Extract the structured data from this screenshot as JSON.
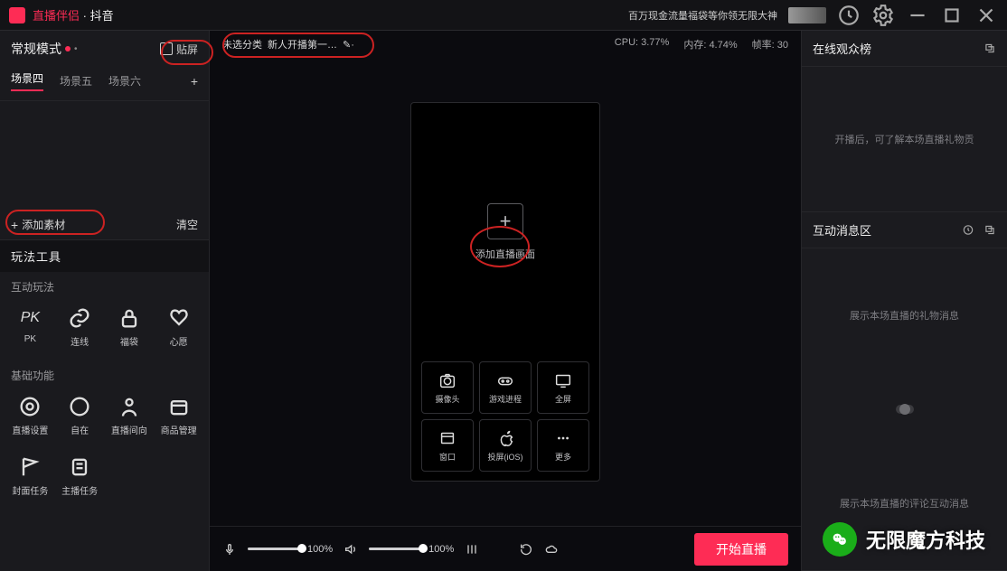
{
  "titlebar": {
    "app_name_a": "直播伴侣",
    "app_name_b": "· 抖音",
    "promo": "百万现金流量福袋等你领无限大神"
  },
  "sidebar": {
    "mode_title": "常规模式",
    "switch_label": "贴屏",
    "scenes": [
      "场景四",
      "场景五",
      "场景六"
    ],
    "add_material": "添加素材",
    "clear_label": "清空",
    "tools_header": "玩法工具",
    "sub1": "互动玩法",
    "tools1": [
      {
        "icon": "pk",
        "label": "PK"
      },
      {
        "icon": "link",
        "label": "连线"
      },
      {
        "icon": "lock",
        "label": "福袋"
      },
      {
        "icon": "heart",
        "label": "心愿"
      }
    ],
    "sub2": "基础功能",
    "tools2": [
      {
        "icon": "gear",
        "label": "直播设置"
      },
      {
        "icon": "org",
        "label": "自在"
      },
      {
        "icon": "person",
        "label": "直播间向"
      },
      {
        "icon": "box",
        "label": "商品管理"
      }
    ],
    "tools3": [
      {
        "icon": "flag",
        "label": "封面任务"
      },
      {
        "icon": "task",
        "label": "主播任务"
      }
    ]
  },
  "center": {
    "title_category": "未选分类",
    "title_text": "新人开播第一…",
    "stats": {
      "cpu": "CPU: 3.77%",
      "mem": "内存: 4.74%",
      "fps": "帧率: 30"
    },
    "add_source_label": "添加直播画面",
    "sources": [
      {
        "label": "摄像头"
      },
      {
        "label": "游戏进程"
      },
      {
        "label": "全屏"
      },
      {
        "label": "窗口"
      },
      {
        "label": "投屏(iOS)"
      },
      {
        "label": "更多"
      }
    ],
    "mic_vol": "100%",
    "spk_vol": "100%",
    "start_btn": "开始直播"
  },
  "right": {
    "audience_title": "在线观众榜",
    "audience_empty": "开播后，可了解本场直播礼物贡",
    "interact_title": "互动消息区",
    "gift_hint": "展示本场直播的礼物消息",
    "msg_hint": "展示本场直播的评论互动消息"
  },
  "watermark": "无限魔方科技"
}
